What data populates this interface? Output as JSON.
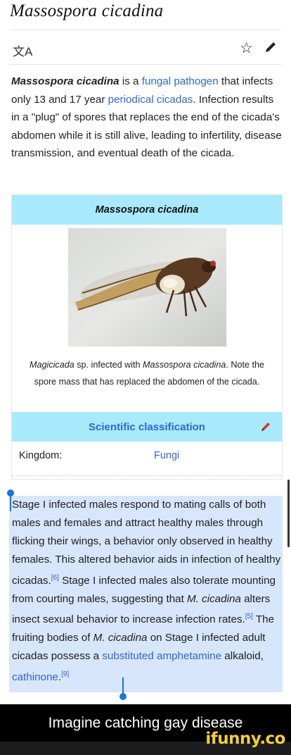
{
  "page": {
    "title": "Massospora cicadina"
  },
  "actions": {
    "language_icon": "translate-icon",
    "star_icon": "star-icon",
    "edit_icon": "pencil-icon"
  },
  "lead": {
    "term": "Massospora cicadina",
    "t1": " is a ",
    "link1": "fungal pathogen",
    "t2": " that infects only 13 and 17 year ",
    "link2": "periodical cicadas",
    "t3": ". Infection results in a \"plug\" of spores that replaces the end of the cicada's abdomen while it is still alive, leading to infertility, disease transmission, and eventual death of the cicada."
  },
  "infobox": {
    "header": "Massospora cicadina",
    "caption_genus": "Magicicada",
    "caption_rest": " sp. infected with ",
    "caption_species": "Massospora cicadina",
    "caption_tail": ". Note the spore mass that has replaced the abdomen of the cicada.",
    "sci_header": "Scientific classification",
    "kingdom_label": "Kingdom:",
    "kingdom_value": "Fungi"
  },
  "selected": {
    "p1": "Stage I infected males respond to mating calls of both males and females and attract healthy males through flicking their wings, a behavior only observed in healthy females. This altered behavior aids in infection of healthy cicadas.",
    "ref1": "[6]",
    "p2": " Stage I infected males also tolerate mounting from courting males, suggesting that ",
    "species1": "M. cicadina",
    "p3": " alters insect sexual behavior to increase infection rates.",
    "ref2": "[5]",
    "p4": " The fruiting bodies of ",
    "species2": "M. cicadina",
    "p5": " on Stage I infected adult cicadas possess a ",
    "link1": "substituted amphetamine",
    "p6": " alkaloid, ",
    "link2": "cathinone",
    "p7": ".",
    "ref3": "[9]"
  },
  "meme": {
    "caption": "Imagine catching gay disease"
  },
  "watermark": {
    "text": "ifunny.co"
  },
  "colors": {
    "link": "#3366cc",
    "infobox_header": "#a8eafc",
    "selection": "#d7e6fb",
    "watermark": "#f4d02e"
  }
}
